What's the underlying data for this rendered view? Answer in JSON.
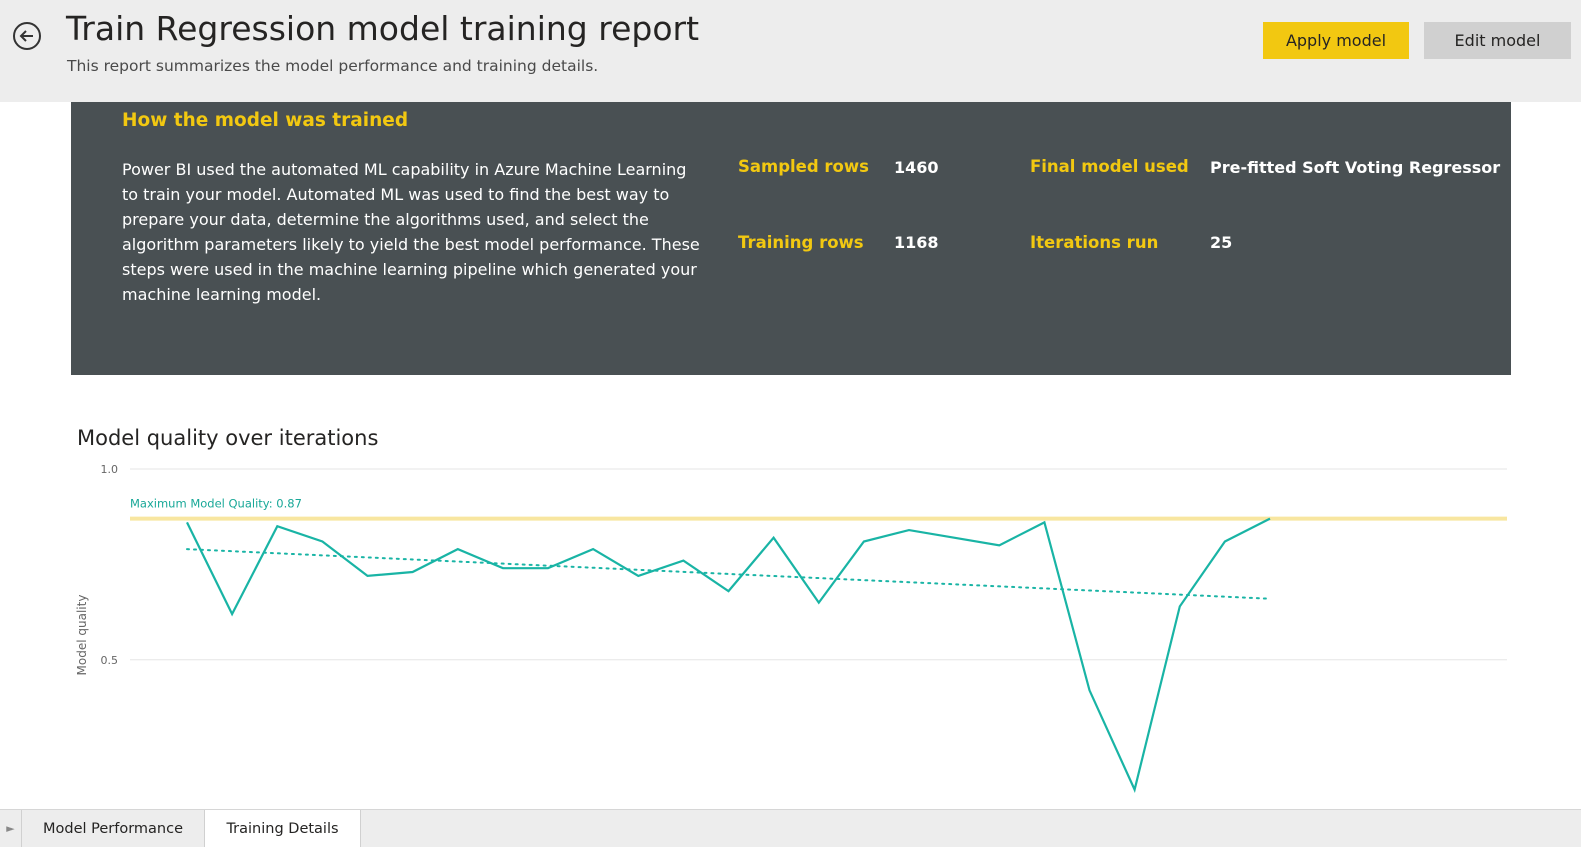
{
  "header": {
    "title": "Train Regression model training report",
    "subtitle": "This report summarizes the model performance and training details.",
    "apply_label": "Apply model",
    "edit_label": "Edit model",
    "back_icon": "back-arrow-icon"
  },
  "panel": {
    "heading": "How the model was trained",
    "description": "Power BI used the automated ML capability in Azure Machine Learning to train your model. Automated ML was used to find the best way to prepare your data, determine the algorithms used, and select the algorithm parameters likely to yield the best model performance. These steps were used in the machine learning pipeline which generated your machine learning model.",
    "sampled_rows_label": "Sampled rows",
    "sampled_rows_value": "1460",
    "training_rows_label": "Training rows",
    "training_rows_value": "1168",
    "final_model_label": "Final model used",
    "final_model_value": "Pre-fitted Soft Voting Regressor",
    "iterations_label": "Iterations run",
    "iterations_value": "25"
  },
  "chart_data": {
    "type": "line",
    "title": "Model quality over iterations",
    "ylabel": "Model quality",
    "xlabel": "",
    "ylim": [
      0.13,
      1.0
    ],
    "yticks": [
      "1.0",
      "0.5"
    ],
    "grid": true,
    "reference_line": {
      "label": "Maximum Model Quality: 0.87",
      "value": 0.87
    },
    "series": [
      {
        "values": [
          0.86,
          0.62,
          0.85,
          0.81,
          0.72,
          0.73,
          0.79,
          0.74,
          0.74,
          0.79,
          0.72,
          0.76,
          0.68,
          0.82,
          0.65,
          0.81,
          0.84,
          0.82,
          0.8,
          0.86,
          0.42,
          0.16,
          0.64,
          0.81,
          0.87
        ]
      }
    ],
    "trendline": [
      0.79,
      0.66
    ],
    "colors": {
      "line": "#19b4a5",
      "reference": "#f8e6a0",
      "grid": "#e6e6e6"
    }
  },
  "tabs": {
    "arrow": "►",
    "items": [
      "Model Performance",
      "Training Details"
    ],
    "active": "Training Details"
  }
}
